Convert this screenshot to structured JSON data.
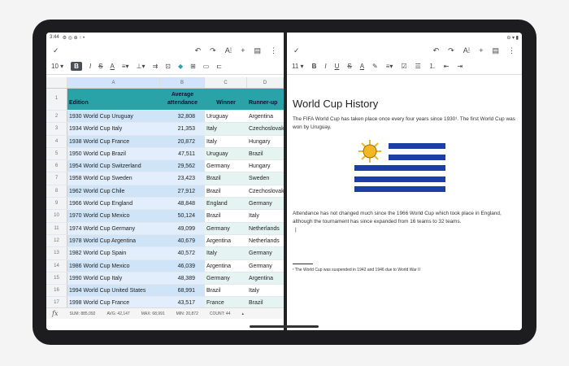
{
  "sheet": {
    "status_time": "3:44",
    "font_size": "10",
    "columns": [
      "A",
      "B",
      "C",
      "D"
    ],
    "header": {
      "edition": "Edition",
      "attendance": "Average attendance",
      "winner": "Winner",
      "runner": "Runner-up"
    },
    "rows": [
      {
        "n": "2",
        "edition": "1930 World Cup Uruguay",
        "att": "32,808",
        "winner": "Uruguay",
        "runner": "Argentina"
      },
      {
        "n": "3",
        "edition": "1934 World Cup Italy",
        "att": "21,353",
        "winner": "Italy",
        "runner": "Czechoslovakia"
      },
      {
        "n": "4",
        "edition": "1938 World Cup France",
        "att": "20,872",
        "winner": "Italy",
        "runner": "Hungary"
      },
      {
        "n": "5",
        "edition": "1950 World Cup Brazil",
        "att": "47,511",
        "winner": "Uruguay",
        "runner": "Brazil"
      },
      {
        "n": "6",
        "edition": "1954 World Cup Switzerland",
        "att": "29,562",
        "winner": "Germany",
        "runner": "Hungary"
      },
      {
        "n": "7",
        "edition": "1958 World Cup Sweden",
        "att": "23,423",
        "winner": "Brazil",
        "runner": "Sweden"
      },
      {
        "n": "8",
        "edition": "1962 World Cup Chile",
        "att": "27,912",
        "winner": "Brazil",
        "runner": "Czechoslovakia"
      },
      {
        "n": "9",
        "edition": "1966 World Cup England",
        "att": "48,848",
        "winner": "England",
        "runner": "Germany"
      },
      {
        "n": "10",
        "edition": "1970 World Cup Mexico",
        "att": "50,124",
        "winner": "Brazil",
        "runner": "Italy"
      },
      {
        "n": "11",
        "edition": "1974 World Cup Germany",
        "att": "49,099",
        "winner": "Germany",
        "runner": "Netherlands"
      },
      {
        "n": "12",
        "edition": "1978 World Cup Argentina",
        "att": "40,679",
        "winner": "Argentina",
        "runner": "Netherlands"
      },
      {
        "n": "13",
        "edition": "1982 World Cup Spain",
        "att": "40,572",
        "winner": "Italy",
        "runner": "Germany"
      },
      {
        "n": "14",
        "edition": "1986 World Cup Mexico",
        "att": "46,039",
        "winner": "Argentina",
        "runner": "Germany"
      },
      {
        "n": "15",
        "edition": "1990 World Cup Italy",
        "att": "48,389",
        "winner": "Germany",
        "runner": "Argentina"
      },
      {
        "n": "16",
        "edition": "1994 World Cup United States",
        "att": "68,991",
        "winner": "Brazil",
        "runner": "Italy"
      },
      {
        "n": "17",
        "edition": "1998 World Cup France",
        "att": "43,517",
        "winner": "France",
        "runner": "Brazil"
      }
    ],
    "stats": {
      "sum": "SUM: 885,092",
      "avg": "AVG: 42,147",
      "max": "MAX: 68,991",
      "min": "MIN: 20,872",
      "count": "COUNT: 44"
    }
  },
  "doc": {
    "font_size": "11",
    "title": "World Cup History",
    "p1": "The FIFA World Cup has taken place once every four years since 1930¹. The first World Cup was won by Uruguay.",
    "p2": "Attendance has not changed much since the 1966 World Cup which took place in England, although the tournament has since expanded from 16 teams to 32 teams.",
    "footnote": "¹ The World Cup was suspended in 1942 and 1946 due to World War II"
  },
  "colors": {
    "header": "#2aa3a8",
    "flag_blue": "#1c3ea5",
    "sun": "#f2b824"
  }
}
